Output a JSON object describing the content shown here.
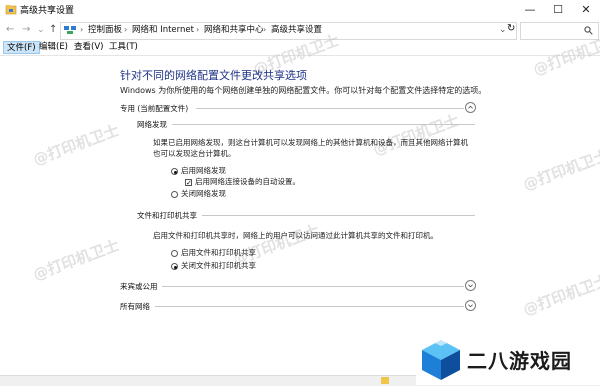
{
  "window": {
    "title": "高级共享设置",
    "minimize": "—",
    "maximize": "☐",
    "close": "✕"
  },
  "addressbar": {
    "back": "←",
    "forward": "→",
    "dropdown": "⌄",
    "up": "↑",
    "crumbs": [
      "控制面板",
      "网络和 Internet",
      "网络和共享中心",
      "高级共享设置"
    ],
    "refresh": "↻"
  },
  "menu": {
    "items": [
      "文件(F)",
      "编辑(E)",
      "查看(V)",
      "工具(T)"
    ]
  },
  "main": {
    "heading": "针对不同的网络配置文件更改共享选项",
    "subtext": "Windows 为你所使用的每个网络创建单独的网络配置文件。你可以针对每个配置文件选择特定的选项。",
    "private_profile": {
      "label": "专用 (当前配置文件)",
      "network_discovery": {
        "label": "网络发现",
        "description": "如果已启用网络发现，则这台计算机可以发现网络上的其他计算机和设备，而且其他网络计算机也可以发现这台计算机。",
        "opt_on": "启用网络发现",
        "opt_auto": "启用网络连接设备的自动设置。",
        "opt_off": "关闭网络发现",
        "selected": "on",
        "auto_checked": true
      },
      "file_sharing": {
        "label": "文件和打印机共享",
        "description": "启用文件和打印机共享时，网络上的用户可以访问通过此计算机共享的文件和打印机。",
        "opt_on": "启用文件和打印机共享",
        "opt_off": "关闭文件和打印机共享",
        "selected": "off"
      }
    },
    "guest_profile": {
      "label": "来宾或公用"
    },
    "all_networks": {
      "label": "所有网络"
    }
  },
  "watermark": "@打印机卫士",
  "brand": {
    "text": "二八游戏园",
    "colors": [
      "#1e7fd8",
      "#5cc2f5",
      "#0d4f9c"
    ]
  }
}
